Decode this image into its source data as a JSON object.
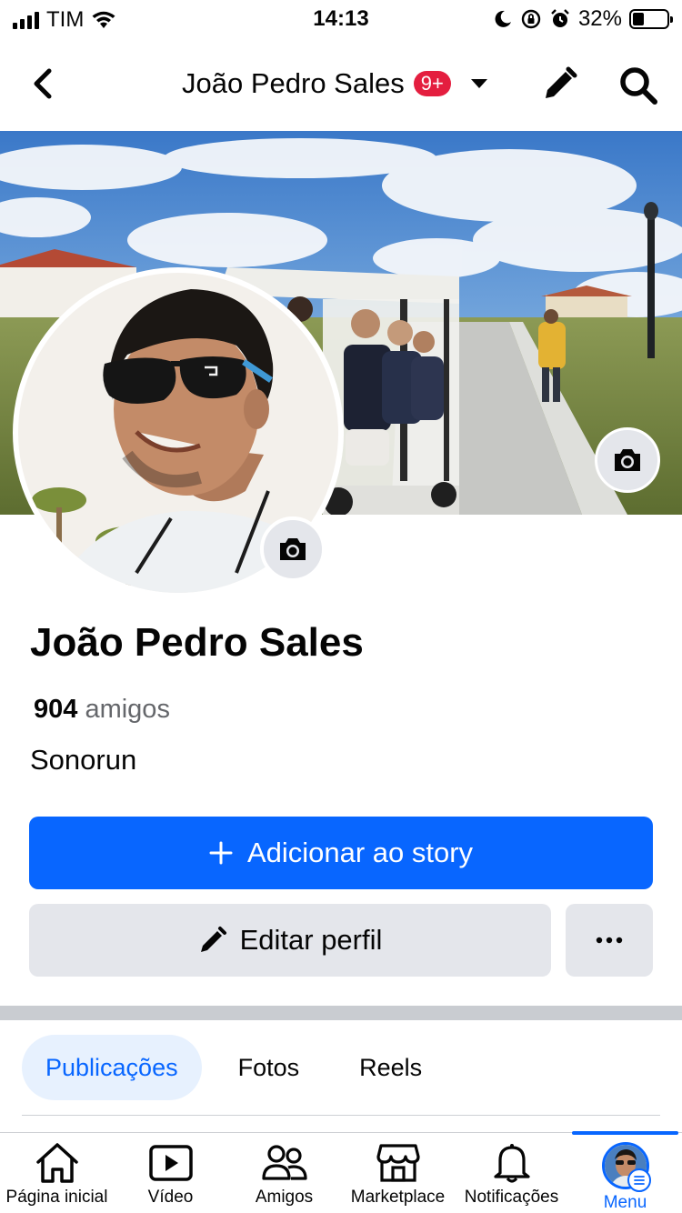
{
  "status_bar": {
    "carrier": "TIM",
    "time": "14:13",
    "battery_percent": "32%",
    "battery_level": 0.32
  },
  "header": {
    "title": "João Pedro Sales",
    "badge": "9+",
    "icons": [
      "back-arrow-icon",
      "dropdown-caret-icon",
      "edit-pencil-icon",
      "search-icon"
    ]
  },
  "profile": {
    "name": "João Pedro Sales",
    "friends_count": "904",
    "friends_label": "amigos",
    "bio": "Sonorun"
  },
  "actions": {
    "add_story": "Adicionar ao story",
    "edit_profile": "Editar perfil",
    "more_icon": "more-dots-icon"
  },
  "tabs": [
    {
      "label": "Publicações",
      "active": true
    },
    {
      "label": "Fotos",
      "active": false
    },
    {
      "label": "Reels",
      "active": false
    }
  ],
  "bottom_nav": [
    {
      "label": "Página inicial",
      "icon": "home-icon",
      "active": false
    },
    {
      "label": "Vídeo",
      "icon": "video-icon",
      "active": false
    },
    {
      "label": "Amigos",
      "icon": "friends-icon",
      "active": false
    },
    {
      "label": "Marketplace",
      "icon": "marketplace-icon",
      "active": false
    },
    {
      "label": "Notificações",
      "icon": "bell-icon",
      "active": false
    },
    {
      "label": "Menu",
      "icon": "profile-avatar",
      "active": true
    }
  ],
  "colors": {
    "primary": "#0866ff",
    "badge": "#e41e3f",
    "secondary_button": "#e4e6eb",
    "active_tab_bg": "#e7f1fe"
  }
}
